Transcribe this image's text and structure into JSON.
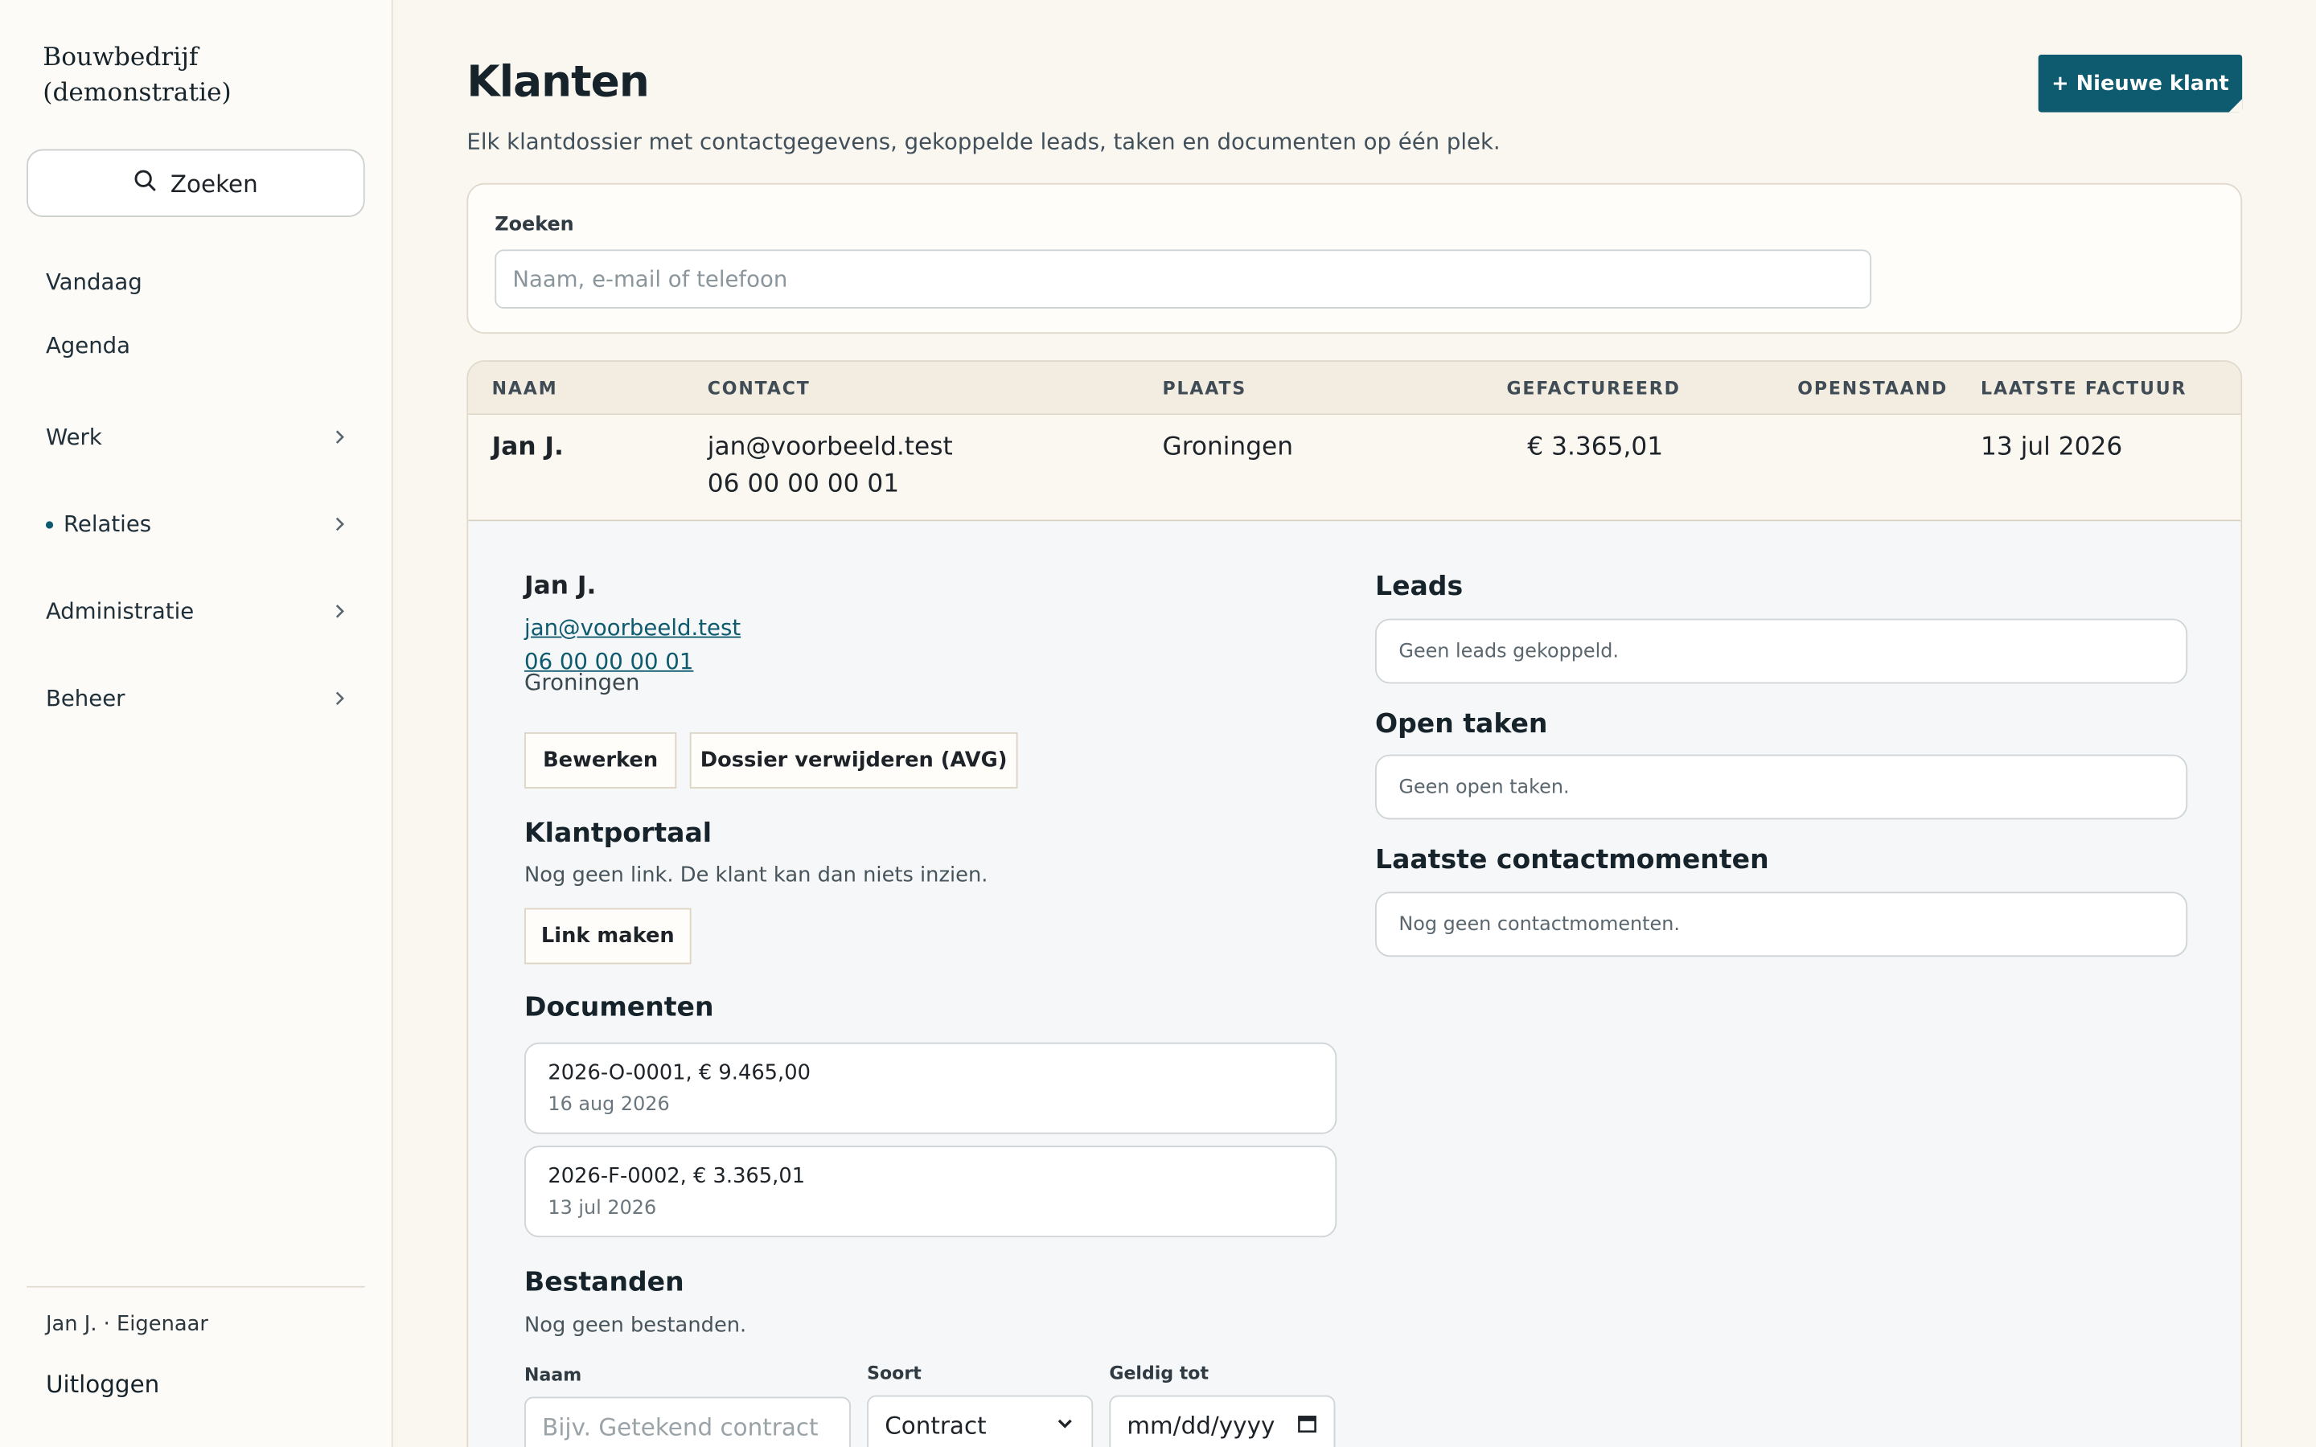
{
  "app": {
    "brand": "Bouwbedrijf (demonstratie)"
  },
  "sidebar": {
    "search_label": "Zoeken",
    "links": [
      "Vandaag",
      "Agenda"
    ],
    "groups": [
      {
        "label": "Werk",
        "active": false
      },
      {
        "label": "Relaties",
        "active": true
      },
      {
        "label": "Administratie",
        "active": false
      },
      {
        "label": "Beheer",
        "active": false
      }
    ],
    "user": "Jan J. · Eigenaar",
    "logout": "Uitloggen"
  },
  "header": {
    "title": "Klanten",
    "subtitle": "Elk klantdossier met contactgegevens, gekoppelde leads, taken en documenten op één plek.",
    "new_button": "+ Nieuwe klant"
  },
  "search": {
    "label": "Zoeken",
    "placeholder": "Naam, e-mail of telefoon",
    "value": ""
  },
  "table": {
    "columns": [
      "NAAM",
      "CONTACT",
      "PLAATS",
      "GEFACTUREERD",
      "OPENSTAAND",
      "LAATSTE FACTUUR"
    ],
    "rows": [
      {
        "naam": "Jan J.",
        "email": "jan@voorbeeld.test",
        "telefoon": "06 00 00 00 01",
        "plaats": "Groningen",
        "gefactureerd": "€ 3.365,01",
        "openstaand": "",
        "laatste_factuur": "13 jul 2026"
      }
    ]
  },
  "detail": {
    "name": "Jan J.",
    "email": "jan@voorbeeld.test",
    "phone": "06 00 00 00 01",
    "city": "Groningen",
    "edit_button": "Bewerken",
    "delete_button": "Dossier verwijderen (AVG)",
    "portal": {
      "title": "Klantportaal",
      "text": "Nog geen link. De klant kan dan niets inzien.",
      "button": "Link maken"
    },
    "documents": {
      "title": "Documenten",
      "items": [
        {
          "title": "2026-O-0001, € 9.465,00",
          "date": "16 aug 2026"
        },
        {
          "title": "2026-F-0002, € 3.365,01",
          "date": "13 jul 2026"
        }
      ]
    },
    "files": {
      "title": "Bestanden",
      "empty": "Nog geen bestanden.",
      "name_label": "Naam",
      "name_placeholder": "Bijv. Getekend contract",
      "type_label": "Soort",
      "type_value": "Contract",
      "valid_label": "Geldig tot",
      "valid_placeholder": "mm/dd/yyyy"
    },
    "leads": {
      "title": "Leads",
      "empty": "Geen leads gekoppeld."
    },
    "tasks": {
      "title": "Open taken",
      "empty": "Geen open taken."
    },
    "contacts": {
      "title": "Laatste contactmomenten",
      "empty": "Nog geen contactmomenten."
    }
  },
  "colors": {
    "accent": "#0e5a6e",
    "background": "#faf7f1",
    "detail_bg": "#f5f7f8"
  }
}
